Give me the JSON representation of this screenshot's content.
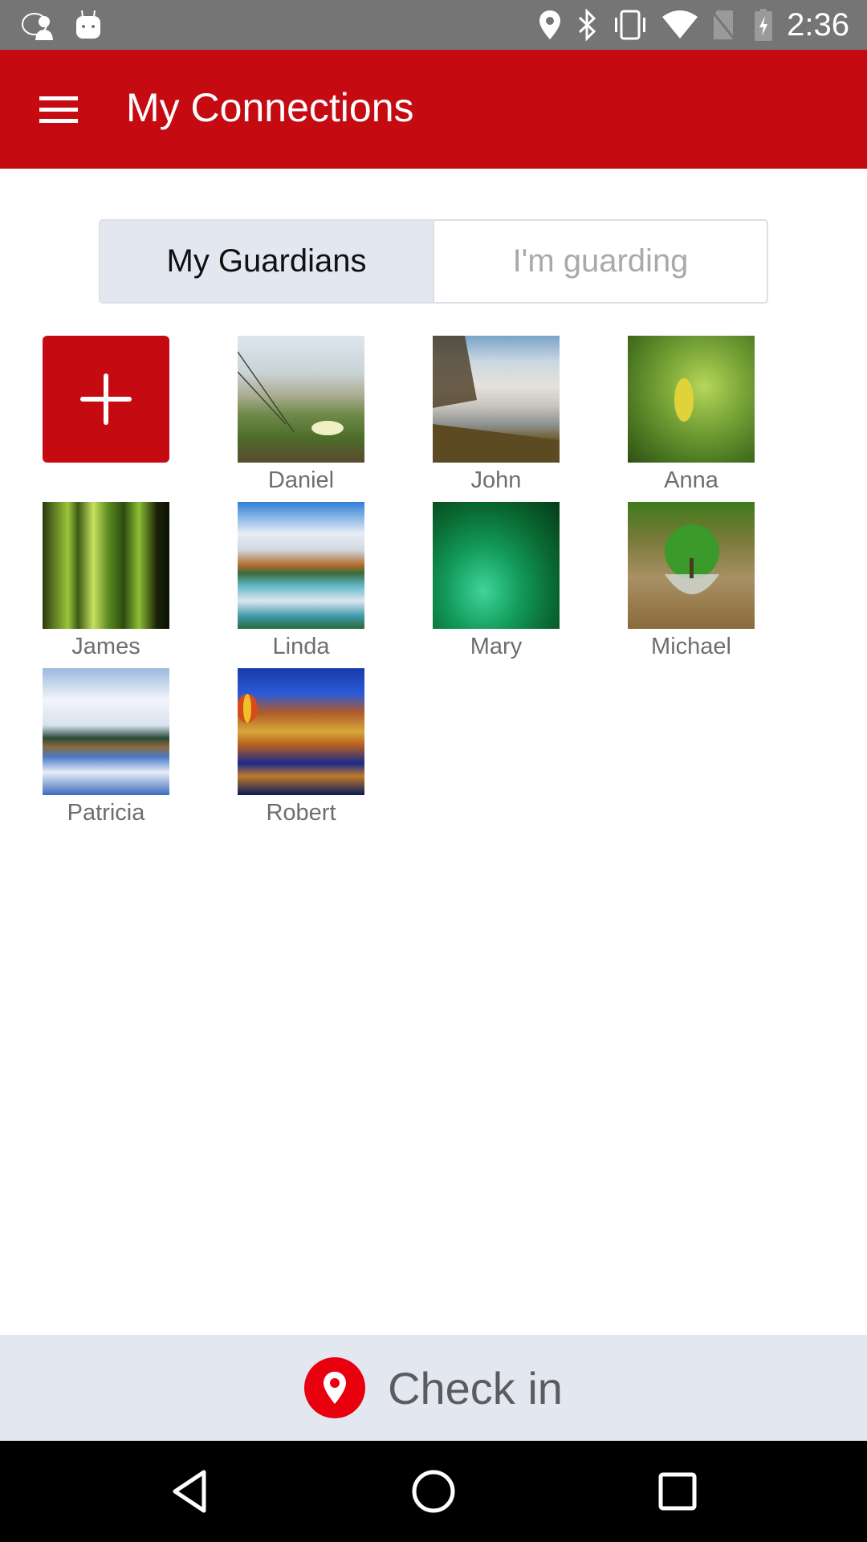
{
  "status_bar": {
    "time": "2:36",
    "left_icons": [
      "guardian-app-notification-icon",
      "android-debug-icon"
    ],
    "right_icons": [
      "location-icon",
      "bluetooth-icon",
      "vibrate-icon",
      "wifi-icon",
      "no-sim-icon",
      "battery-charging-icon"
    ]
  },
  "app_bar": {
    "title": "My Connections",
    "menu_icon": "hamburger-menu-icon",
    "color": "#C60A12"
  },
  "tabs": [
    {
      "label": "My Guardians",
      "active": true
    },
    {
      "label": "I'm guarding",
      "active": false
    }
  ],
  "add_button": {
    "icon": "plus-icon",
    "label": "Add guardian"
  },
  "guardians": [
    {
      "name": "Daniel",
      "photo": "grass-flower-dune"
    },
    {
      "name": "John",
      "photo": "waterfall"
    },
    {
      "name": "Anna",
      "photo": "green-leaves"
    },
    {
      "name": "James",
      "photo": "forest-trees"
    },
    {
      "name": "Linda",
      "photo": "mountain-lake-reflection"
    },
    {
      "name": "Mary",
      "photo": "green-river"
    },
    {
      "name": "Michael",
      "photo": "tree-in-glass"
    },
    {
      "name": "Patricia",
      "photo": "snow-mountain-reflection"
    },
    {
      "name": "Robert",
      "photo": "canyon-balloon"
    }
  ],
  "checkin": {
    "label": "Check in",
    "icon": "location-pin-icon",
    "color": "#e8000f"
  },
  "nav_bar": {
    "back": "back-icon",
    "home": "home-icon",
    "recents": "recents-icon"
  }
}
